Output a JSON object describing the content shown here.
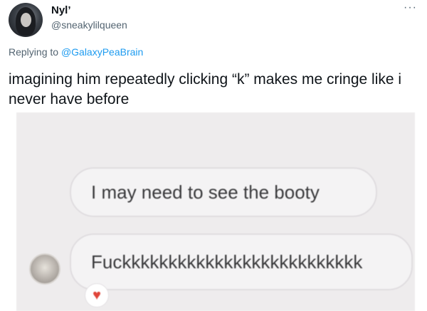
{
  "tweet": {
    "display_name": "Nyl’",
    "handle": "@sneakylilqueen",
    "more_label": "···",
    "reply_prefix": "Replying to ",
    "reply_mention": "@GalaxyPeaBrain",
    "text": "imagining him repeatedly clicking “k” makes me cringe like i never have before"
  },
  "media": {
    "message_1": "I may need to see the booty",
    "message_2": "Fuckkkkkkkkkkkkkkkkkkkkkkkkkk",
    "reaction": "♥"
  },
  "icons": {
    "more": "more-dots-icon",
    "heart": "heart-icon"
  },
  "colors": {
    "link": "#1d9bf0",
    "secondary_text": "#536471",
    "heart": "#e0453a"
  }
}
